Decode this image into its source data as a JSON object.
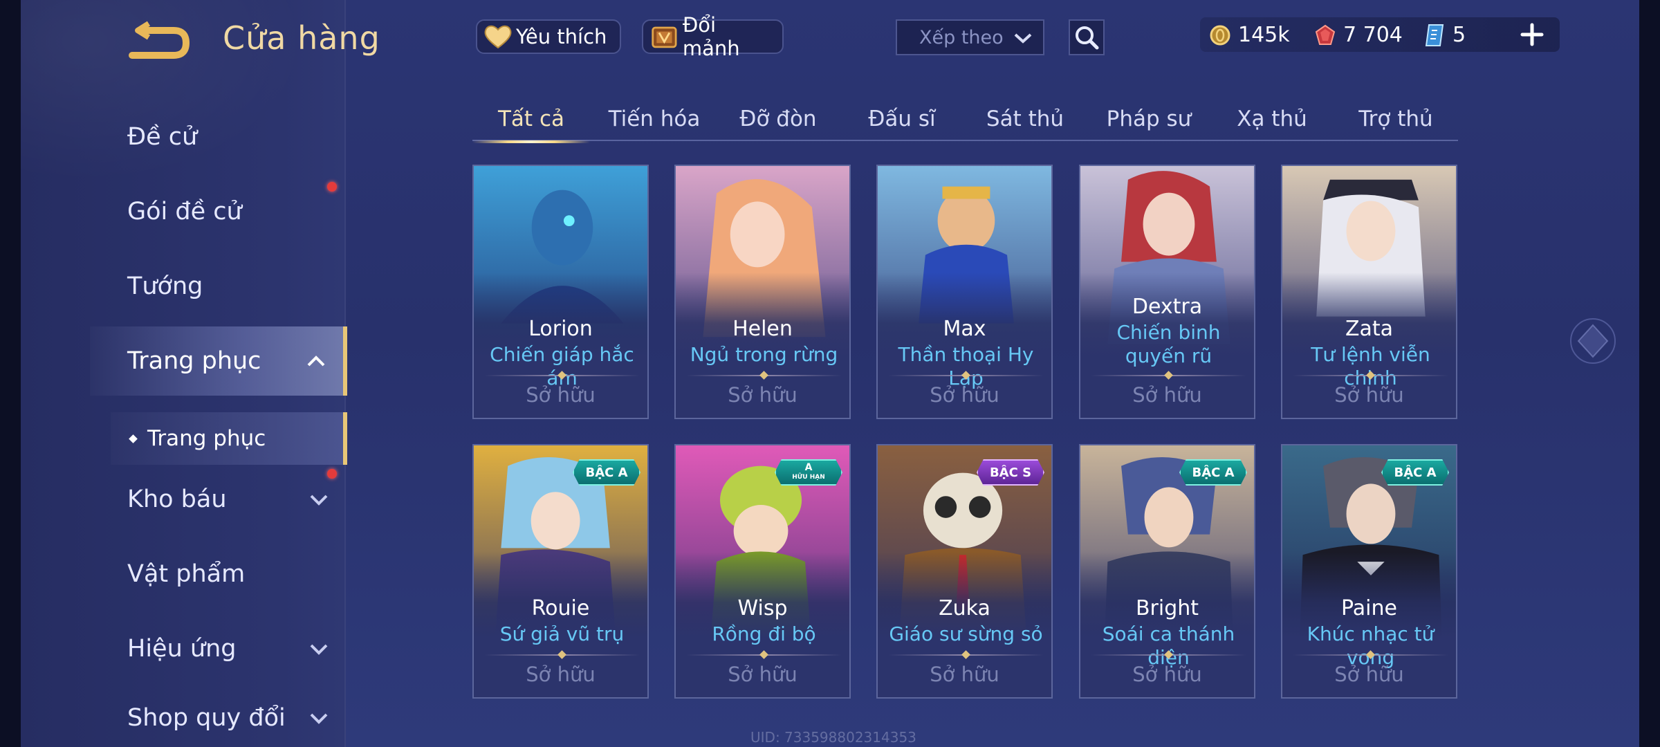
{
  "header": {
    "title": "Cửa hàng",
    "favorite_label": "Yêu thích",
    "exchange_label": "Đổi mảnh",
    "sort_placeholder": "Xếp theo"
  },
  "currency": {
    "gold": "145k",
    "ruby": "7 704",
    "voucher": "5"
  },
  "sidebar": {
    "items": [
      {
        "label": "Đề cử"
      },
      {
        "label": "Gói đề cử"
      },
      {
        "label": "Tướng"
      },
      {
        "label": "Trang phục"
      },
      {
        "label": "Kho báu"
      },
      {
        "label": "Vật phẩm"
      },
      {
        "label": "Hiệu ứng"
      },
      {
        "label": "Shop quy đổi"
      }
    ],
    "sub_item": "Trang phục"
  },
  "tabs": [
    "Tất cả",
    "Tiến hóa",
    "Đỡ đòn",
    "Đấu sĩ",
    "Sát thủ",
    "Pháp sư",
    "Xạ thủ",
    "Trợ thủ"
  ],
  "cards": [
    {
      "hero": "Lorion",
      "skin": "Chiến giáp hắc ám",
      "status": "Sở hữu",
      "tier": ""
    },
    {
      "hero": "Helen",
      "skin": "Ngủ trong rừng",
      "status": "Sở hữu",
      "tier": ""
    },
    {
      "hero": "Max",
      "skin": "Thần thoại Hy Lạp",
      "status": "Sở hữu",
      "tier": ""
    },
    {
      "hero": "Dextra",
      "skin": "Chiến binh quyến rũ",
      "status": "Sở hữu",
      "tier": ""
    },
    {
      "hero": "Zata",
      "skin": "Tư lệnh viễn chinh",
      "status": "Sở hữu",
      "tier": ""
    },
    {
      "hero": "Rouie",
      "skin": "Sứ giả vũ trụ",
      "status": "Sở hữu",
      "tier": "BẬC A"
    },
    {
      "hero": "Wisp",
      "skin": "Rồng đi bộ",
      "status": "Sở hữu",
      "tier": "A",
      "tier_sub": "HỮU HẠN"
    },
    {
      "hero": "Zuka",
      "skin": "Giáo sư sừng sỏ",
      "status": "Sở hữu",
      "tier": "BẬC S"
    },
    {
      "hero": "Bright",
      "skin": "Soái ca thánh diện",
      "status": "Sở hữu",
      "tier": "BẬC A"
    },
    {
      "hero": "Paine",
      "skin": "Khúc nhạc tử vong",
      "status": "Sở hữu",
      "tier": "BẬC A"
    }
  ],
  "footer": {
    "uid": "UID: 733598802314353"
  },
  "colors": {
    "accent_gold": "#f0d9a4",
    "skin_name": "#67c8f5",
    "tier_teal": "#1aa8a0",
    "tier_purple": "#9a4bd9"
  }
}
